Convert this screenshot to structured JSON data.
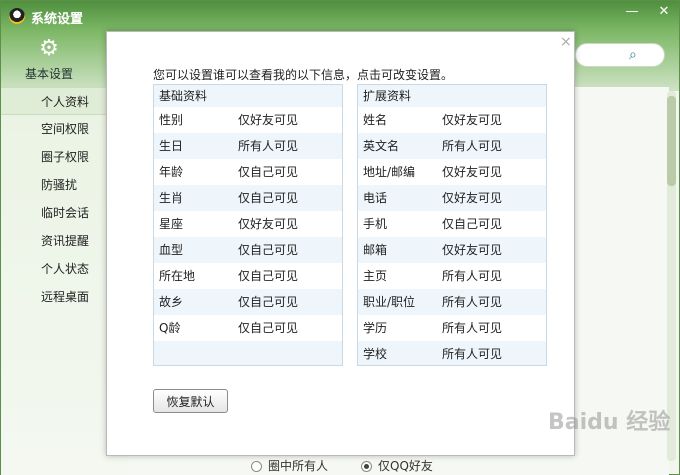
{
  "window": {
    "title": "系统设置",
    "minimize": "—",
    "close": "✕"
  },
  "toolbar": {
    "basic_settings": "基本设置"
  },
  "sidebar": {
    "items": [
      "个人资料",
      "空间权限",
      "圈子权限",
      "防骚扰",
      "临时会话",
      "资讯提醒",
      "个人状态",
      "远程桌面"
    ],
    "active_index": 0
  },
  "background": {
    "radio1": "圈中所有人",
    "radio2": "仅QQ好友"
  },
  "dialog": {
    "close": "×",
    "intro": "您可以设置谁可以查看我的以下信息，点击可改变设置。",
    "basic": {
      "title": "基础资料",
      "rows": [
        {
          "field": "性别",
          "value": "仅好友可见"
        },
        {
          "field": "生日",
          "value": "所有人可见"
        },
        {
          "field": "年龄",
          "value": "仅自己可见"
        },
        {
          "field": "生肖",
          "value": "仅自己可见"
        },
        {
          "field": "星座",
          "value": "仅好友可见"
        },
        {
          "field": "血型",
          "value": "仅自己可见"
        },
        {
          "field": "所在地",
          "value": "仅自己可见"
        },
        {
          "field": "故乡",
          "value": "仅自己可见"
        },
        {
          "field": "Q龄",
          "value": "仅自己可见"
        }
      ]
    },
    "extended": {
      "title": "扩展资料",
      "rows": [
        {
          "field": "姓名",
          "value": "仅好友可见"
        },
        {
          "field": "英文名",
          "value": "所有人可见"
        },
        {
          "field": "地址/邮编",
          "value": "仅好友可见"
        },
        {
          "field": "电话",
          "value": "仅好友可见"
        },
        {
          "field": "手机",
          "value": "仅自己可见"
        },
        {
          "field": "邮箱",
          "value": "仅好友可见"
        },
        {
          "field": "主页",
          "value": "所有人可见"
        },
        {
          "field": "职业/职位",
          "value": "所有人可见"
        },
        {
          "field": "学历",
          "value": "所有人可见"
        },
        {
          "field": "学校",
          "value": "所有人可见"
        }
      ]
    },
    "reset_button": "恢复默认"
  },
  "watermark": "Baidu 经验"
}
